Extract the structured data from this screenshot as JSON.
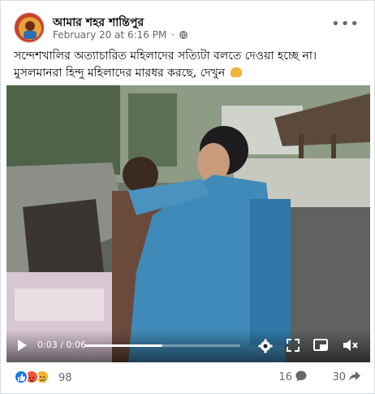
{
  "post": {
    "page_name": "আমার শহর শান্তিপুর",
    "timestamp": "February 20 at 6:16 PM",
    "separator": "·",
    "privacy_icon": "globe-icon",
    "more_icon": "more-options-icon",
    "caption_line1": "সন্দেশখালির অত্যাচারিত মহিলাদের সত্যিটা বলতে দেওয়া হচ্ছে না।",
    "caption_line2": "মুসলমানরা হিন্দু মহিলাদের মারধর করছে, দেখুন"
  },
  "video": {
    "current_time": "0:03",
    "duration": "0:06",
    "time_separator": " / ",
    "progress_fraction": 0.5,
    "icons": [
      "play-icon",
      "settings-icon",
      "fullscreen-icon",
      "picture-in-picture-icon",
      "mute-icon"
    ]
  },
  "engagement": {
    "reaction_count": "98",
    "reaction_icons": [
      "like-icon",
      "angry-icon",
      "sad-icon"
    ],
    "comment_count": "16",
    "share_count": "30"
  },
  "colors": {
    "like": "#1877f2",
    "angry": "#f5533d",
    "sad": "#f7b125",
    "meta_text": "#65676b"
  }
}
